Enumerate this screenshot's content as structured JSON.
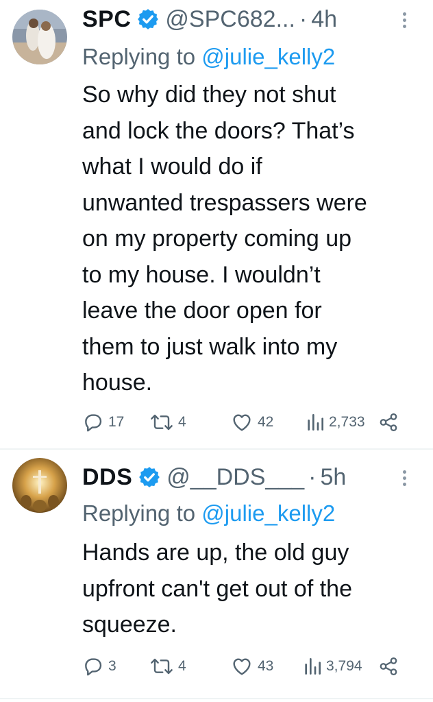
{
  "tweets": [
    {
      "name": "SPC",
      "handle": "@SPC682...",
      "separator": "·",
      "time": "4h",
      "replying_prefix": "Replying to",
      "replying_to": "@julie_kelly2",
      "body_lines": [
        "So why did they not shut",
        "and lock the doors? That’s",
        "what I would do if",
        "unwanted trespassers were",
        "on my property coming up",
        "to my house. I wouldn’t",
        "leave the door open for",
        "them to just walk into my",
        "house."
      ],
      "replies": "17",
      "retweets": "4",
      "likes": "42",
      "views": "2,733"
    },
    {
      "name": "DDS",
      "handle": "@__DDS___",
      "separator": "·",
      "time": "5h",
      "replying_prefix": "Replying to",
      "replying_to": "@julie_kelly2",
      "body_lines": [
        "Hands are up, the old guy",
        "upfront can't get out of the",
        "squeeze."
      ],
      "replies": "3",
      "retweets": "4",
      "likes": "43",
      "views": "3,794"
    }
  ],
  "icons": {
    "verified": "verified-badge-icon",
    "more": "more-vertical-icon",
    "reply": "reply-icon",
    "retweet": "retweet-icon",
    "like": "heart-icon",
    "views": "views-bar-chart-icon",
    "share": "share-icon"
  },
  "colors": {
    "accent": "#1d9bf0",
    "muted": "#536471",
    "text": "#0f1419"
  }
}
